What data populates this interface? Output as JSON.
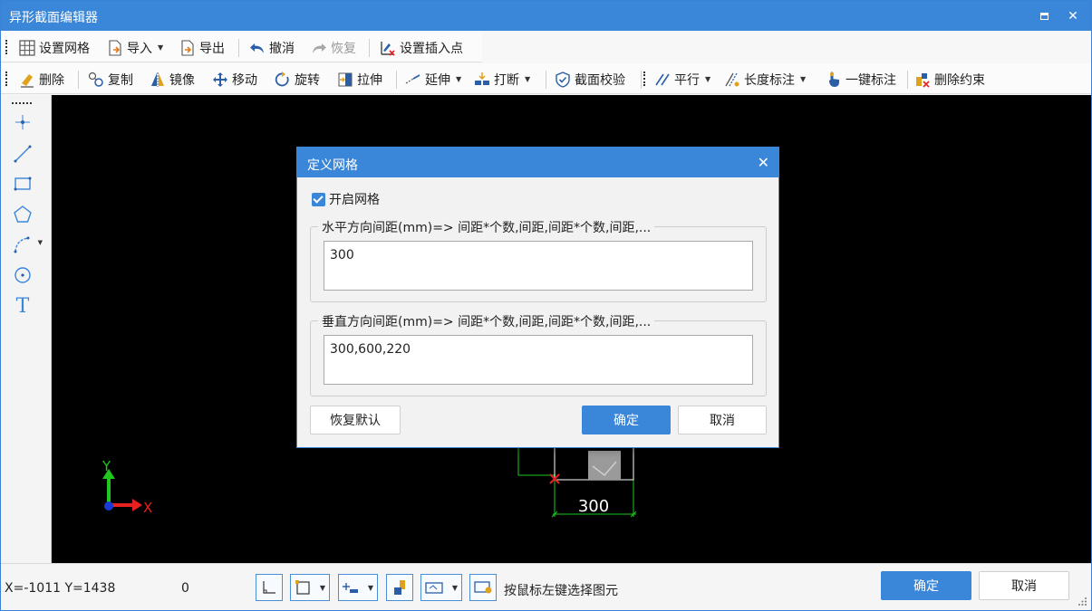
{
  "window": {
    "title": "异形截面编辑器",
    "maximize_icon": "maximize-icon",
    "close_glyph": "✕"
  },
  "toolbar1": {
    "items": [
      {
        "label": "设置网格",
        "icon": "grid-icon"
      },
      {
        "label": "导入",
        "icon": "import-icon",
        "dropdown": true
      },
      {
        "label": "导出",
        "icon": "export-icon"
      },
      {
        "label": "撤消",
        "icon": "undo-icon"
      },
      {
        "label": "恢复",
        "icon": "redo-icon",
        "disabled": true
      },
      {
        "label": "设置插入点",
        "icon": "insert-point-icon"
      }
    ]
  },
  "toolbar2": {
    "items": [
      {
        "label": "删除",
        "icon": "eraser-icon"
      },
      {
        "label": "复制",
        "icon": "copy-icon"
      },
      {
        "label": "镜像",
        "icon": "mirror-icon"
      },
      {
        "label": "移动",
        "icon": "move-icon"
      },
      {
        "label": "旋转",
        "icon": "rotate-icon"
      },
      {
        "label": "拉伸",
        "icon": "stretch-icon"
      },
      {
        "label": "延伸",
        "icon": "extend-icon",
        "dropdown": true
      },
      {
        "label": "打断",
        "icon": "break-icon",
        "dropdown": true
      },
      {
        "label": "截面校验",
        "icon": "check-shield-icon"
      },
      {
        "label": "平行",
        "icon": "parallel-icon",
        "dropdown": true
      },
      {
        "label": "长度标注",
        "icon": "length-dim-icon",
        "dropdown": true
      },
      {
        "label": "一键标注",
        "icon": "one-click-dim-icon"
      },
      {
        "label": "删除约束",
        "icon": "delete-constraint-icon"
      }
    ]
  },
  "left_tools": [
    "point-icon",
    "line-icon",
    "rectangle-icon",
    "polygon-icon",
    "arc-icon",
    "circle-icon",
    "text-icon"
  ],
  "left_text_tool_glyph": "T",
  "canvas": {
    "axis_y_label": "Y",
    "axis_x_label": "X",
    "dimension_text": "300",
    "colors": {
      "background": "#000000",
      "axis_y": "#1ec81e",
      "axis_x": "#e82020",
      "dimension": "#1ec81e",
      "insert_point": "#e82020"
    }
  },
  "dialog": {
    "title": "定义网格",
    "close_glyph": "✕",
    "enable_grid_label": "开启网格",
    "enable_grid_checked": true,
    "horizontal_legend": "水平方向间距(mm)=> 间距*个数,间距,间距*个数,间距,...",
    "horizontal_value": "300",
    "vertical_legend": "垂直方向间距(mm)=> 间距*个数,间距,间距*个数,间距,...",
    "vertical_value": "300,600,220",
    "restore_default_label": "恢复默认",
    "ok_label": "确定",
    "cancel_label": "取消"
  },
  "status": {
    "coords": "X=-1011 Y=1438",
    "value": "0",
    "hint": "按鼠标左键选择图元",
    "ok_label": "确定",
    "cancel_label": "取消"
  },
  "colors": {
    "accent": "#3a86d8"
  }
}
